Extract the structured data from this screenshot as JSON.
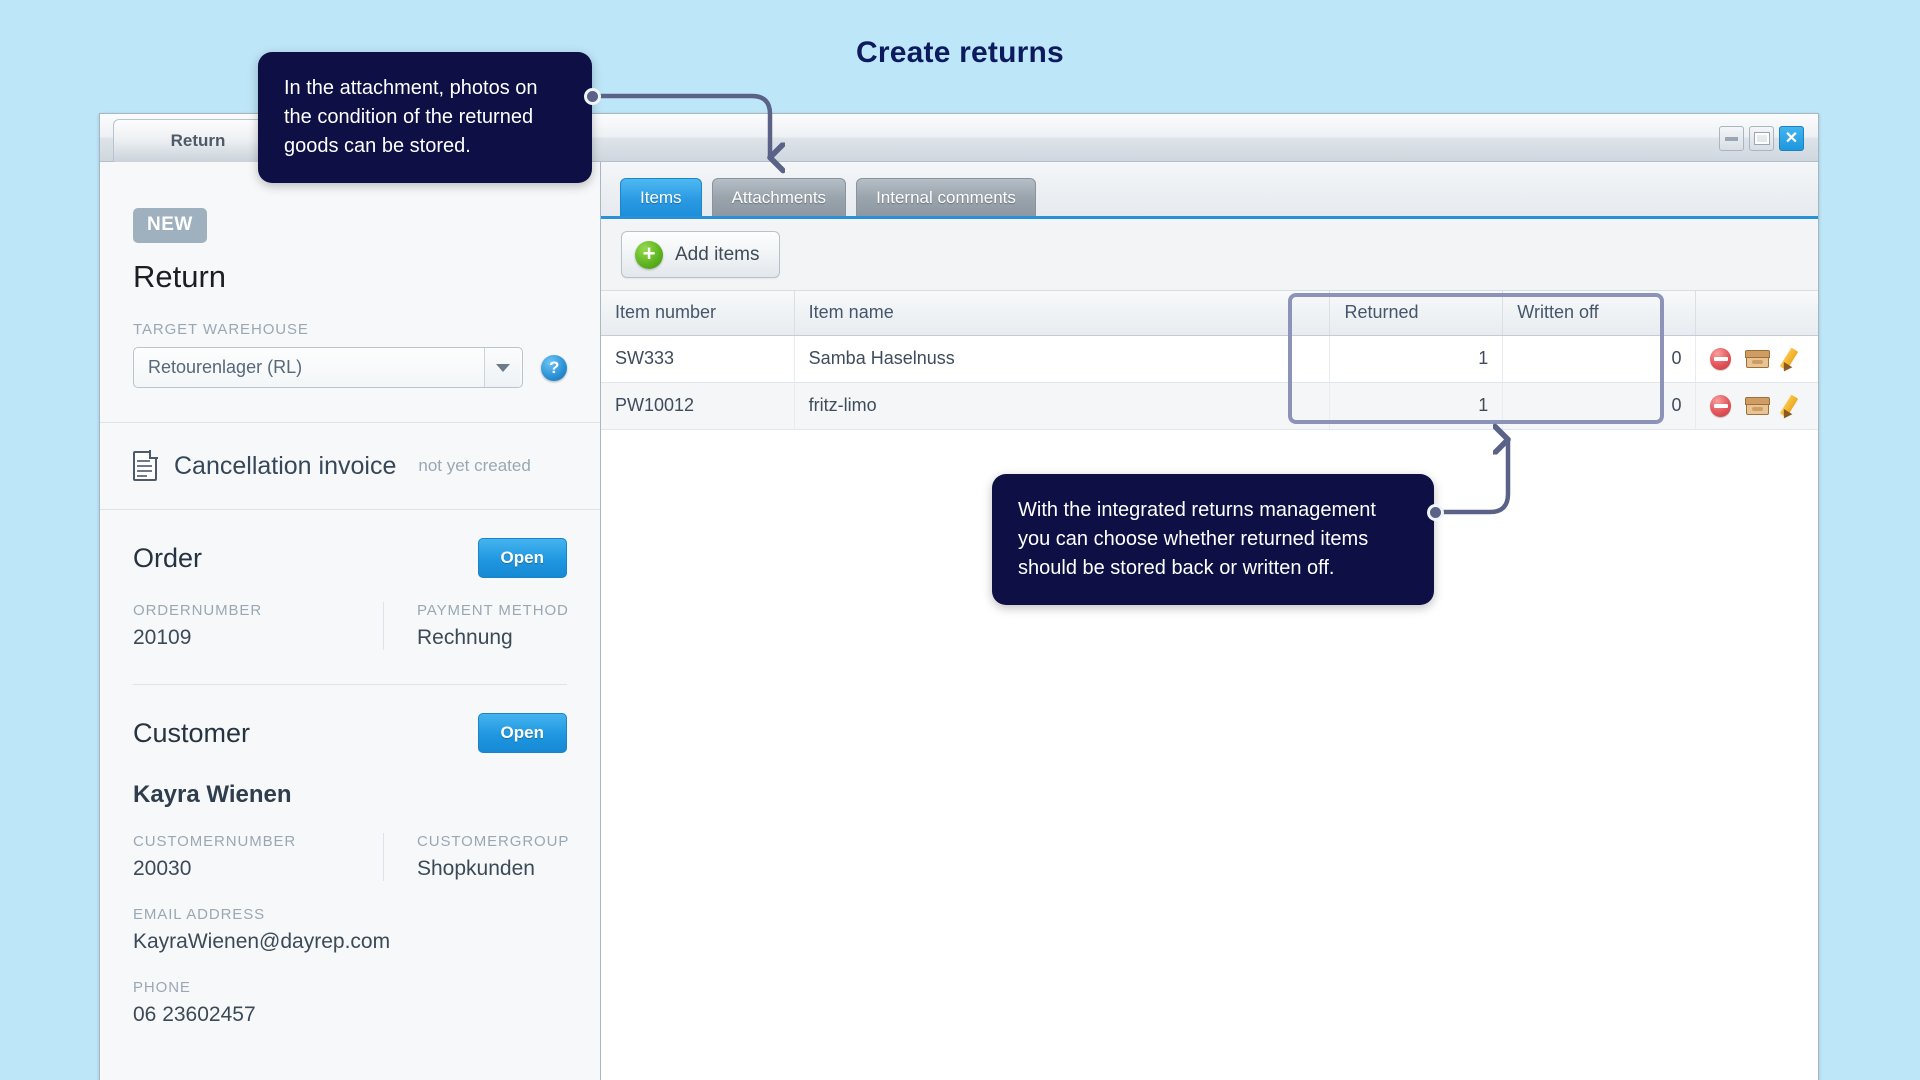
{
  "page": {
    "title": "Create returns",
    "background": "#bde6f8"
  },
  "window": {
    "tab_title": "Return",
    "controls": {
      "minimize": "minimize-icon",
      "maximize": "maximize-icon",
      "close": "✕"
    }
  },
  "left_pane": {
    "status_badge": "NEW",
    "heading": "Return",
    "target_warehouse": {
      "label": "TARGET WAREHOUSE",
      "value": "Retourenlager (RL)",
      "help": "?"
    },
    "cancellation_invoice": {
      "title": "Cancellation invoice",
      "status": "not yet created"
    },
    "order": {
      "title": "Order",
      "open_label": "Open",
      "fields": [
        {
          "label": "ORDERNUMBER",
          "value": "20109"
        },
        {
          "label": "PAYMENT METHOD",
          "value": "Rechnung"
        }
      ]
    },
    "customer": {
      "title": "Customer",
      "open_label": "Open",
      "name": "Kayra Wienen",
      "fields": [
        {
          "label": "CUSTOMERNUMBER",
          "value": "20030"
        },
        {
          "label": "CUSTOMERGROUP",
          "value": "Shopkunden"
        }
      ],
      "email": {
        "label": "EMAIL ADDRESS",
        "value": "KayraWienen@dayrep.com"
      },
      "phone": {
        "label": "PHONE",
        "value": "06 23602457"
      }
    }
  },
  "right_pane": {
    "tabs": [
      {
        "label": "Items",
        "active": true
      },
      {
        "label": "Attachments",
        "active": false
      },
      {
        "label": "Internal comments",
        "active": false
      }
    ],
    "toolbar": {
      "add_items_label": "Add items",
      "add_icon": "plus-circle-icon"
    },
    "table": {
      "columns": [
        "Item number",
        "Item name",
        "Returned",
        "Written off",
        ""
      ],
      "rows": [
        {
          "item_number": "SW333",
          "item_name": "Samba Haselnuss",
          "returned": "1",
          "written_off": "0"
        },
        {
          "item_number": "PW10012",
          "item_name": "fritz-limo",
          "returned": "1",
          "written_off": "0"
        }
      ],
      "row_actions": [
        "delete-icon",
        "storage-box-icon",
        "edit-pencil-icon"
      ],
      "highlight_color": "#8d93b8"
    }
  },
  "callouts": [
    {
      "id": "callout-1",
      "text": "In the attachment, photos on the condition of the returned goods can be stored.",
      "points_to": "Attachments tab"
    },
    {
      "id": "callout-2",
      "text": "With the integrated returns management you can choose whether returned items should be stored back or written off.",
      "points_to": "Returned / Written off columns"
    }
  ],
  "colors": {
    "accent_blue": "#2a91d8",
    "callout_navy": "#0d0f45",
    "arrow_purple": "#5a6287",
    "badge_gray": "#9fb0be"
  }
}
